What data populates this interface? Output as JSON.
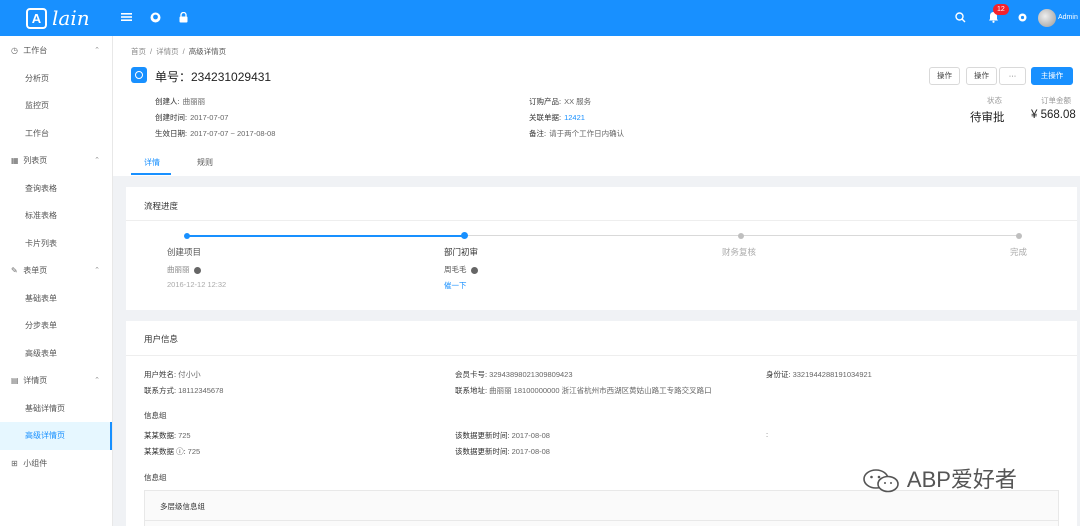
{
  "topbar": {
    "logo_letter": "A",
    "logo_text": "lain",
    "menu_icon": "menu-icon",
    "github_icon": "github-icon",
    "lock_icon": "lock-icon",
    "search_icon": "search-icon",
    "bell_icon": "bell-icon",
    "notification_count": "12",
    "settings_icon": "gear-icon",
    "user_name": "Admin"
  },
  "sidebar": {
    "groups": [
      {
        "label": "工作台",
        "icon": "dashboard-icon",
        "items": [
          "分析页",
          "监控页",
          "工作台"
        ]
      },
      {
        "label": "列表页",
        "icon": "table-icon",
        "items": [
          "查询表格",
          "标准表格",
          "卡片列表"
        ]
      },
      {
        "label": "表单页",
        "icon": "edit-icon",
        "items": [
          "基础表单",
          "分步表单",
          "高级表单"
        ]
      },
      {
        "label": "详情页",
        "icon": "profile-icon",
        "items": [
          "基础详情页",
          "高级详情页"
        ]
      },
      {
        "label": "小组件",
        "icon": "appstore-icon",
        "items": []
      }
    ]
  },
  "breadcrumb": [
    "首页",
    "/",
    "详情页",
    "/",
    "高级详情页"
  ],
  "header": {
    "title": "单号：234231029431",
    "buttons": [
      "操作",
      "操作",
      "···",
      "主操作"
    ],
    "desc": {
      "creator_label": "创建人:",
      "creator": "曲丽丽",
      "created_label": "创建时间:",
      "created": "2017-07-07",
      "effective_label": "生效日期:",
      "effective": "2017-07-07 ~ 2017-08-08",
      "product_label": "订购产品:",
      "product": "XX 服务",
      "related_label": "关联单据:",
      "related": "12421",
      "remark_label": "备注:",
      "remark": "请于两个工作日内确认"
    },
    "status_label": "状态",
    "status": "待审批",
    "amount_label": "订单金额",
    "amount": "¥ 568.08",
    "tabs": [
      "详情",
      "规则"
    ]
  },
  "progress": {
    "title": "流程进度",
    "steps": [
      {
        "title": "创建项目",
        "person": "曲丽丽",
        "time": "2016-12-12 12:32"
      },
      {
        "title": "部门初审",
        "person": "周毛毛",
        "link": "催一下"
      },
      {
        "title": "财务复核"
      },
      {
        "title": "完成"
      }
    ],
    "colors": {
      "done": "#1890ff",
      "todo": "#bfbfbf"
    }
  },
  "user_info": {
    "title": "用户信息",
    "name_label": "用户姓名:",
    "name": "付小小",
    "card_label": "会员卡号:",
    "card": "32943898021309809423",
    "id_label": "身份证:",
    "id": "3321944288191034921",
    "phone_label": "联系方式:",
    "phone": "18112345678",
    "addr_label": "联系地址:",
    "addr": "曲丽丽 18100000000 浙江省杭州市西湖区黄姑山路工专路交叉路口",
    "group1_title": "信息组",
    "d1_label": "某某数据:",
    "d1": "725",
    "u1_label": "该数据更新时间:",
    "u1": "2017-08-08",
    "colon": ":",
    "d2_label": "某某数据 ⓘ:",
    "d2": "725",
    "u2_label": "该数据更新时间:",
    "u2": "2017-08-08",
    "group2_title": "信息组",
    "multi_title": "多层级信息组"
  },
  "watermark": "ABP爱好者"
}
